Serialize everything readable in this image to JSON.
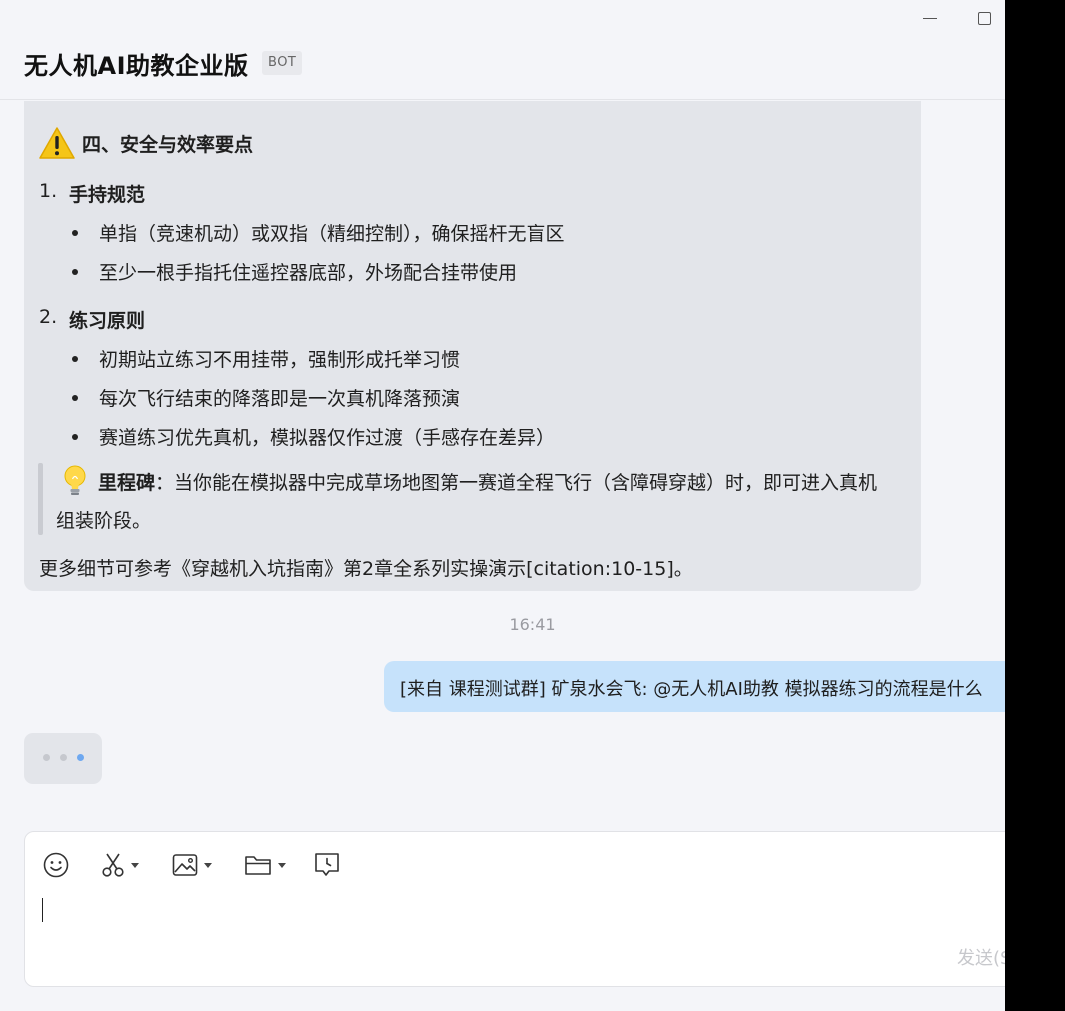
{
  "window": {
    "minimize_icon": "minimize-icon",
    "maximize_icon": "maximize-icon"
  },
  "header": {
    "title": "无人机AI助教企业版",
    "badge": "BOT"
  },
  "bot_message": {
    "section_icon": "warning-icon",
    "section_title": "四、安全与效率要点",
    "items": [
      {
        "number": "1.",
        "title": "手持规范",
        "bullets": [
          "单指（竞速机动）或双指（精细控制），确保摇杆无盲区",
          "至少一根手指托住遥控器底部，外场配合挂带使用"
        ]
      },
      {
        "number": "2.",
        "title": "练习原则",
        "bullets": [
          "初期站立练习不用挂带，强制形成托举习惯",
          "每次飞行结束的降落即是一次真机降落预演",
          "赛道练习优先真机，模拟器仅作过渡（手感存在差异）"
        ]
      }
    ],
    "quote": {
      "icon": "lightbulb-icon",
      "bold": "里程碑",
      "line1_rest": "：当你能在模拟器中完成草场地图第一赛道全程飞行（含障碍穿越）时，即可进入真机",
      "line2": "组装阶段。"
    },
    "footer": "更多细节可参考《穿越机入坑指南》第2章全系列实操演示[citation:10-15]。"
  },
  "timestamp": "16:41",
  "user_message": "[来自 课程测试群] 矿泉水会飞: @无人机AI助教 模拟器练习的流程是什么",
  "composer": {
    "tools": [
      "emoji-icon",
      "scissors-icon",
      "image-icon",
      "folder-icon",
      "chat-history-icon"
    ],
    "input_value": "",
    "send_label": "发送(S)"
  },
  "colors": {
    "app_background": "#f4f5f9",
    "bot_bubble": "#e3e5ea",
    "user_bubble": "#c6e2fb",
    "typing_active_dot": "#6ea8f0"
  }
}
